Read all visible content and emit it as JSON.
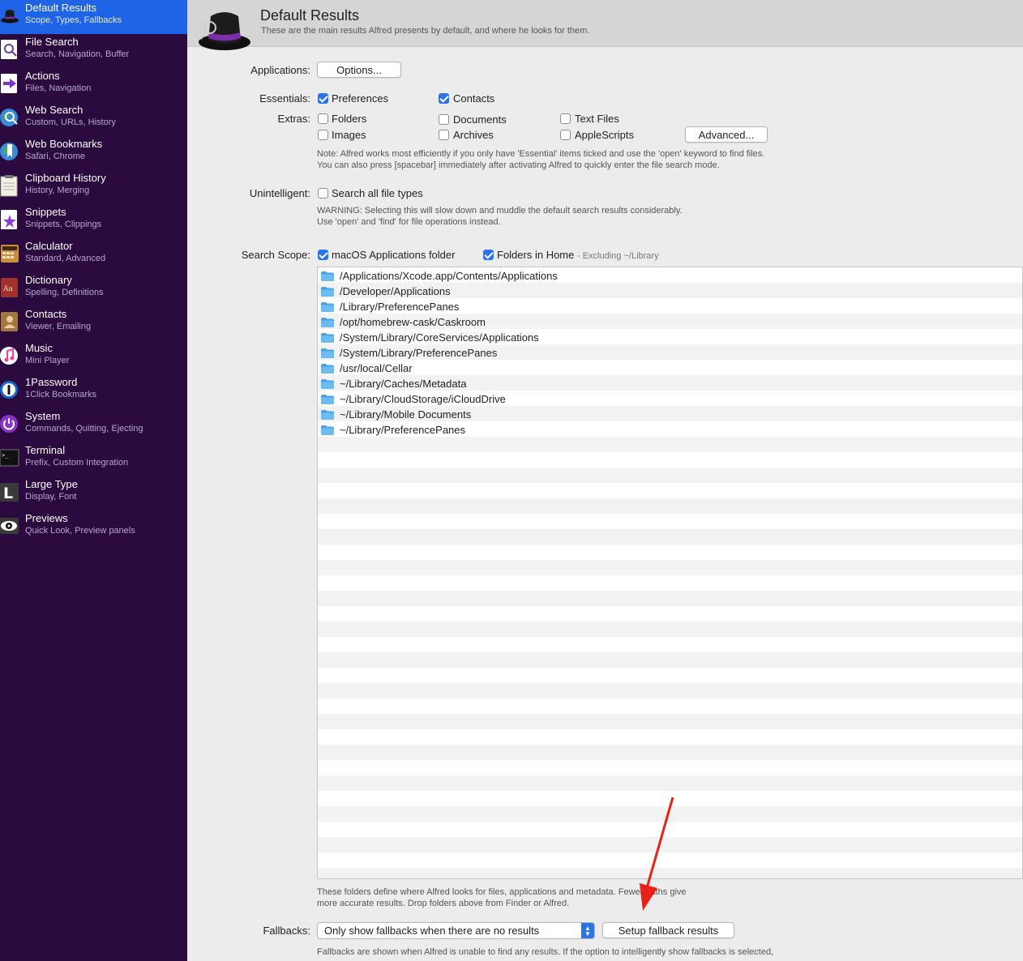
{
  "sidebar": {
    "items": [
      {
        "title": "Default Results",
        "subtitle": "Scope, Types, Fallbacks",
        "icon": "alfred-hat-icon",
        "active": true
      },
      {
        "title": "File Search",
        "subtitle": "Search, Navigation, Buffer",
        "icon": "magnifier-document-icon"
      },
      {
        "title": "Actions",
        "subtitle": "Files, Navigation",
        "icon": "arrow-right-icon"
      },
      {
        "title": "Web Search",
        "subtitle": "Custom, URLs, History",
        "icon": "globe-search-icon"
      },
      {
        "title": "Web Bookmarks",
        "subtitle": "Safari, Chrome",
        "icon": "globe-bookmark-icon"
      },
      {
        "title": "Clipboard History",
        "subtitle": "History, Merging",
        "icon": "clipboard-icon"
      },
      {
        "title": "Snippets",
        "subtitle": "Snippets, Clippings",
        "icon": "snippet-star-icon"
      },
      {
        "title": "Calculator",
        "subtitle": "Standard, Advanced",
        "icon": "calculator-icon"
      },
      {
        "title": "Dictionary",
        "subtitle": "Spelling, Definitions",
        "icon": "dictionary-icon"
      },
      {
        "title": "Contacts",
        "subtitle": "Viewer, Emailing",
        "icon": "contacts-book-icon"
      },
      {
        "title": "Music",
        "subtitle": "Mini Player",
        "icon": "music-note-icon"
      },
      {
        "title": "1Password",
        "subtitle": "1Click Bookmarks",
        "icon": "onepassword-icon"
      },
      {
        "title": "System",
        "subtitle": "Commands, Quitting, Ejecting",
        "icon": "power-icon"
      },
      {
        "title": "Terminal",
        "subtitle": "Prefix, Custom Integration",
        "icon": "terminal-icon"
      },
      {
        "title": "Large Type",
        "subtitle": "Display, Font",
        "icon": "large-type-l-icon"
      },
      {
        "title": "Previews",
        "subtitle": "Quick Look, Preview panels",
        "icon": "eye-icon"
      }
    ]
  },
  "header": {
    "title": "Default Results",
    "subtitle": "These are the main results Alfred presents by default, and where he looks for them."
  },
  "applications": {
    "label": "Applications:",
    "options_button": "Options..."
  },
  "essentials": {
    "label": "Essentials:",
    "preferences": {
      "label": "Preferences",
      "checked": true
    },
    "contacts": {
      "label": "Contacts",
      "checked": true
    }
  },
  "extras": {
    "label": "Extras:",
    "folders": {
      "label": "Folders",
      "checked": false
    },
    "documents": {
      "label": "Documents",
      "checked": false
    },
    "text_files": {
      "label": "Text Files",
      "checked": false
    },
    "images": {
      "label": "Images",
      "checked": false
    },
    "archives": {
      "label": "Archives",
      "checked": false
    },
    "applescripts": {
      "label": "AppleScripts",
      "checked": false
    },
    "advanced_button": "Advanced...",
    "note_line1": "Note: Alfred works most efficiently if you only have 'Essential' items ticked and use the 'open' keyword to find files.",
    "note_line2": "You can also press [spacebar] immediately after activating Alfred to quickly enter the file search mode."
  },
  "unintelligent": {
    "label": "Unintelligent:",
    "search_all": {
      "label": "Search all file types",
      "checked": false
    },
    "warning_line1": "WARNING: Selecting this will slow down and muddle the default search results considerably.",
    "warning_line2": "Use 'open' and 'find' for file operations instead."
  },
  "search_scope": {
    "label": "Search Scope:",
    "macos_apps": {
      "label": "macOS Applications folder",
      "checked": true
    },
    "home_folders": {
      "label": "Folders in Home",
      "checked": true
    },
    "excluding": "- Excluding ~/Library",
    "folders": [
      "/Applications/Xcode.app/Contents/Applications",
      "/Developer/Applications",
      "/Library/PreferencePanes",
      "/opt/homebrew-cask/Caskroom",
      "/System/Library/CoreServices/Applications",
      "/System/Library/PreferencePanes",
      "/usr/local/Cellar",
      "~/Library/Caches/Metadata",
      "~/Library/CloudStorage/iCloudDrive",
      "~/Library/Mobile Documents",
      "~/Library/PreferencePanes"
    ],
    "note_line1": "These folders define where Alfred looks for files, applications and metadata. Fewer paths give",
    "note_line2": "more accurate results. Drop folders above from Finder or Alfred."
  },
  "fallbacks": {
    "label": "Fallbacks:",
    "selected": "Only show fallbacks when there are no results",
    "setup_button": "Setup fallback results",
    "note": "Fallbacks are shown when Alfred is unable to find any results. If the option to intelligently show fallbacks is selected,"
  },
  "colors": {
    "sidebar_bg": "#2a0a3f",
    "active_item": "#1f63e6",
    "checkbox_accent": "#2a74e8",
    "annotation_arrow": "#e8201a"
  }
}
